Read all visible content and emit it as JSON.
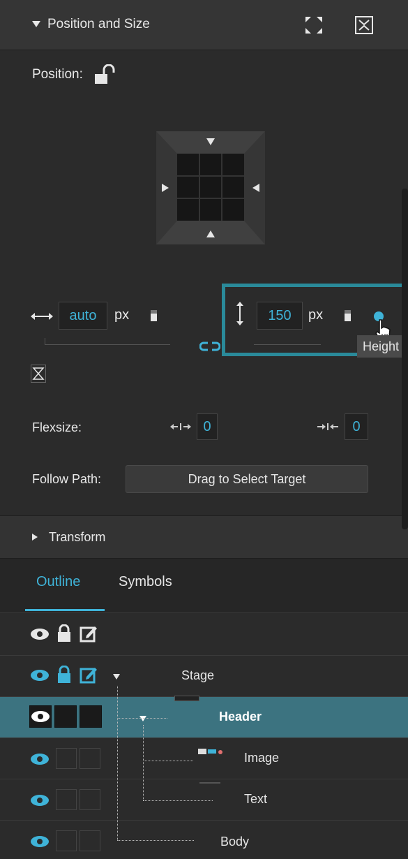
{
  "panel": {
    "title": "Position and Size",
    "position_label": "Position:",
    "width_value": "auto",
    "width_unit": "px",
    "height_value": "150",
    "height_unit": "px",
    "tooltip": "Height",
    "flexsize_label": "Flexsize:",
    "flex_grow_value": "0",
    "flex_shrink_value": "0",
    "follow_path_label": "Follow Path:",
    "follow_path_button": "Drag to Select Target",
    "transform_label": "Transform"
  },
  "tabs": [
    {
      "label": "Outline",
      "active": true
    },
    {
      "label": "Symbols",
      "active": false
    }
  ],
  "outline": {
    "rows": [
      {
        "label": "Stage"
      },
      {
        "label": "Header",
        "selected": true
      },
      {
        "label": "Image"
      },
      {
        "label": "Text"
      },
      {
        "label": "Body"
      }
    ]
  },
  "colors": {
    "accent": "#3fb3d8",
    "highlight_box": "#2a8a9a",
    "selected_row": "#3c7380",
    "panel_bg": "#2b2b2b"
  }
}
